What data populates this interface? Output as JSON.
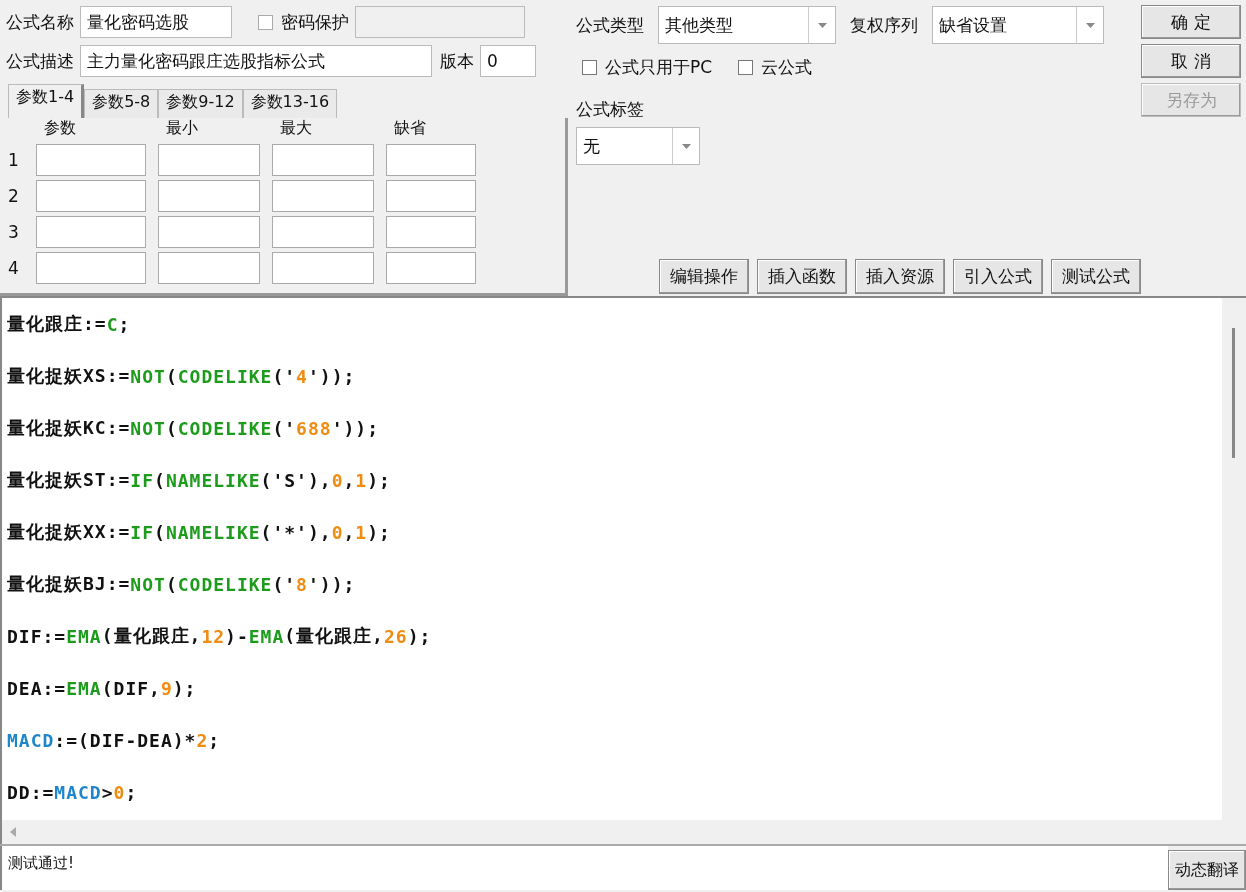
{
  "formula_name": {
    "label": "公式名称",
    "value": "量化密码选股"
  },
  "password_protect": {
    "label": "密码保护",
    "checked": false,
    "disabled": true
  },
  "formula_desc": {
    "label": "公式描述",
    "value": "主力量化密码跟庄选股指标公式"
  },
  "version": {
    "label": "版本",
    "value": "0"
  },
  "formula_type": {
    "label": "公式类型",
    "value": "其他类型"
  },
  "adjust_order": {
    "label": "复权序列",
    "value": "缺省设置"
  },
  "options": [
    {
      "label": "公式只用于PC",
      "checked": false
    },
    {
      "label": "云公式",
      "checked": false
    }
  ],
  "formula_tag": {
    "label": "公式标签",
    "value": "无"
  },
  "side_buttons": [
    {
      "label": "确 定",
      "disabled": false
    },
    {
      "label": "取 消",
      "disabled": false
    },
    {
      "label": "另存为",
      "disabled": true
    }
  ],
  "tabs": [
    {
      "label": "参数1-4",
      "selected": true
    },
    {
      "label": "参数5-8",
      "selected": false
    },
    {
      "label": "参数9-12",
      "selected": false
    },
    {
      "label": "参数13-16",
      "selected": false
    }
  ],
  "param_table": {
    "columns": [
      "参数",
      "最小",
      "最大",
      "缺省"
    ],
    "rows": [
      "1",
      "2",
      "3",
      "4"
    ]
  },
  "tool_buttons": [
    "编辑操作",
    "插入函数",
    "插入资源",
    "引入公式",
    "测试公式"
  ],
  "code_lines": [
    [
      {
        "kind": "text",
        "text": "量化跟庄:="
      },
      {
        "kind": "func",
        "text": "C"
      },
      {
        "kind": "text",
        "text": ";"
      }
    ],
    [
      {
        "kind": "text",
        "text": "量化捉妖XS:="
      },
      {
        "kind": "func",
        "text": "NOT"
      },
      {
        "kind": "text",
        "text": "("
      },
      {
        "kind": "func",
        "text": "CODELIKE"
      },
      {
        "kind": "text",
        "text": "('"
      },
      {
        "kind": "num",
        "text": "4"
      },
      {
        "kind": "text",
        "text": "'));"
      }
    ],
    [
      {
        "kind": "text",
        "text": "量化捉妖KC:="
      },
      {
        "kind": "func",
        "text": "NOT"
      },
      {
        "kind": "text",
        "text": "("
      },
      {
        "kind": "func",
        "text": "CODELIKE"
      },
      {
        "kind": "text",
        "text": "('"
      },
      {
        "kind": "num",
        "text": "688"
      },
      {
        "kind": "text",
        "text": "'));"
      }
    ],
    [
      {
        "kind": "text",
        "text": "量化捉妖ST:="
      },
      {
        "kind": "func",
        "text": "IF"
      },
      {
        "kind": "text",
        "text": "("
      },
      {
        "kind": "func",
        "text": "NAMELIKE"
      },
      {
        "kind": "text",
        "text": "('S'),"
      },
      {
        "kind": "num",
        "text": "0"
      },
      {
        "kind": "text",
        "text": ","
      },
      {
        "kind": "num",
        "text": "1"
      },
      {
        "kind": "text",
        "text": ");"
      }
    ],
    [
      {
        "kind": "text",
        "text": "量化捉妖XX:="
      },
      {
        "kind": "func",
        "text": "IF"
      },
      {
        "kind": "text",
        "text": "("
      },
      {
        "kind": "func",
        "text": "NAMELIKE"
      },
      {
        "kind": "text",
        "text": "('*'),"
      },
      {
        "kind": "num",
        "text": "0"
      },
      {
        "kind": "text",
        "text": ","
      },
      {
        "kind": "num",
        "text": "1"
      },
      {
        "kind": "text",
        "text": ");"
      }
    ],
    [
      {
        "kind": "text",
        "text": "量化捉妖BJ:="
      },
      {
        "kind": "func",
        "text": "NOT"
      },
      {
        "kind": "text",
        "text": "("
      },
      {
        "kind": "func",
        "text": "CODELIKE"
      },
      {
        "kind": "text",
        "text": "('"
      },
      {
        "kind": "num",
        "text": "8"
      },
      {
        "kind": "text",
        "text": "'));"
      }
    ],
    [
      {
        "kind": "text",
        "text": "DIF:="
      },
      {
        "kind": "func",
        "text": "EMA"
      },
      {
        "kind": "text",
        "text": "(量化跟庄,"
      },
      {
        "kind": "num",
        "text": "12"
      },
      {
        "kind": "text",
        "text": ")-"
      },
      {
        "kind": "func",
        "text": "EMA"
      },
      {
        "kind": "text",
        "text": "(量化跟庄,"
      },
      {
        "kind": "num",
        "text": "26"
      },
      {
        "kind": "text",
        "text": ");"
      }
    ],
    [
      {
        "kind": "text",
        "text": "DEA:="
      },
      {
        "kind": "func",
        "text": "EMA"
      },
      {
        "kind": "text",
        "text": "(DIF,"
      },
      {
        "kind": "num",
        "text": "9"
      },
      {
        "kind": "text",
        "text": ");"
      }
    ],
    [
      {
        "kind": "var",
        "text": "MACD"
      },
      {
        "kind": "text",
        "text": ":=(DIF-DEA)*"
      },
      {
        "kind": "num",
        "text": "2"
      },
      {
        "kind": "text",
        "text": ";"
      }
    ],
    [
      {
        "kind": "text",
        "text": "DD:="
      },
      {
        "kind": "var",
        "text": "MACD"
      },
      {
        "kind": "text",
        "text": ">"
      },
      {
        "kind": "num",
        "text": "0"
      },
      {
        "kind": "text",
        "text": ";"
      }
    ]
  ],
  "status": {
    "text": "测试通过!",
    "button": "动态翻译"
  }
}
